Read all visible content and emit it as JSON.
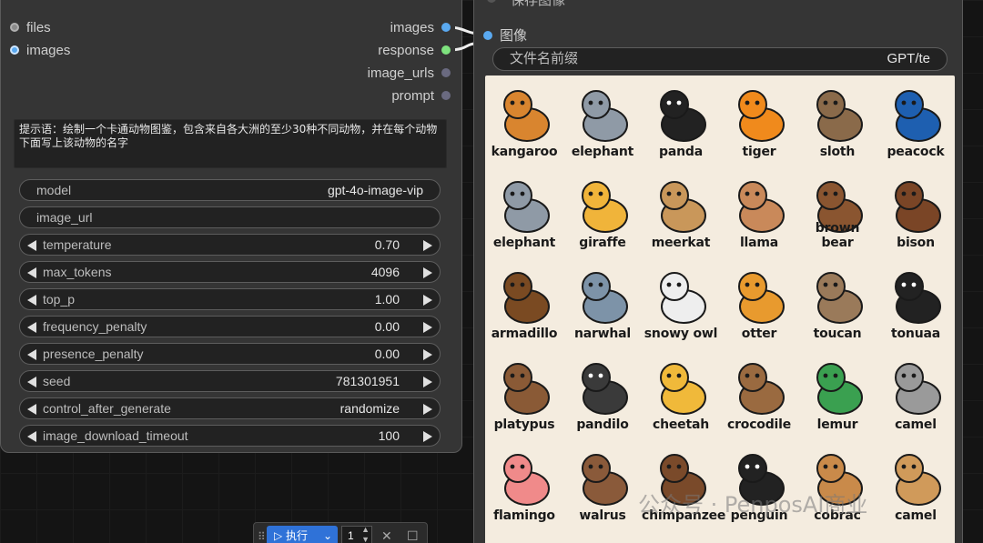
{
  "left_node": {
    "inputs": [
      {
        "label": "files",
        "color": "#8a8a8a"
      },
      {
        "label": "images",
        "color": "#5aa9f0"
      }
    ],
    "outputs": [
      {
        "label": "images",
        "color": "#5aa9f0"
      },
      {
        "label": "response",
        "color": "#7ee27e"
      },
      {
        "label": "image_urls",
        "color": "#6a6a80"
      },
      {
        "label": "prompt",
        "color": "#6a6a80"
      }
    ],
    "prompt_text": "提示语：绘制一个卡通动物图鉴，包含来自各大洲的至少30种不同动物，并在每个动物下面写上该动物的名字",
    "widgets": {
      "model": {
        "label": "model",
        "value": "gpt-4o-image-vip"
      },
      "image_url": {
        "label": "image_url",
        "value": ""
      },
      "temperature": {
        "label": "temperature",
        "value": "0.70"
      },
      "max_tokens": {
        "label": "max_tokens",
        "value": "4096"
      },
      "top_p": {
        "label": "top_p",
        "value": "1.00"
      },
      "frequency_penalty": {
        "label": "frequency_penalty",
        "value": "0.00"
      },
      "presence_penalty": {
        "label": "presence_penalty",
        "value": "0.00"
      },
      "seed": {
        "label": "seed",
        "value": "781301951"
      },
      "control_after_generate": {
        "label": "control_after_generate",
        "value": "randomize"
      },
      "image_download_timeout": {
        "label": "image_download_timeout",
        "value": "100"
      }
    }
  },
  "right_node": {
    "title": "保存图像",
    "input_label": "图像",
    "filename_prefix": {
      "label": "文件名前缀",
      "value": "GPT/te"
    },
    "animals": [
      {
        "name": "kangaroo",
        "color": "#d9852f"
      },
      {
        "name": "elephant",
        "color": "#8f9aa6"
      },
      {
        "name": "panda",
        "color": "#222222"
      },
      {
        "name": "tiger",
        "color": "#f08a1c"
      },
      {
        "name": "sloth",
        "color": "#8a6a4a"
      },
      {
        "name": "peacock",
        "color": "#1e5fb0"
      },
      {
        "name": "elephant",
        "color": "#8f9aa6"
      },
      {
        "name": "giraffe",
        "color": "#f0b43a"
      },
      {
        "name": "meerkat",
        "color": "#c9975a"
      },
      {
        "name": "llama",
        "color": "#c9895a"
      },
      {
        "name": "brown bear",
        "color": "#8a5530"
      },
      {
        "name": "bison",
        "color": "#7a4526"
      },
      {
        "name": "armadillo",
        "color": "#7a4a22"
      },
      {
        "name": "narwhal",
        "color": "#7d93a8"
      },
      {
        "name": "snowy owl",
        "color": "#eeeeee"
      },
      {
        "name": "otter",
        "color": "#e89a2e"
      },
      {
        "name": "toucan",
        "color": "#9a7a5a"
      },
      {
        "name": "tonuaa",
        "color": "#222222"
      },
      {
        "name": "platypus",
        "color": "#8a5a36"
      },
      {
        "name": "pandilo",
        "color": "#3a3a3a"
      },
      {
        "name": "cheetah",
        "color": "#f0b93a"
      },
      {
        "name": "crocodile",
        "color": "#9a6a40"
      },
      {
        "name": "lemur",
        "color": "#3aa050"
      },
      {
        "name": "camel",
        "color": "#9a9a9a"
      },
      {
        "name": "flamingo",
        "color": "#f08a8a"
      },
      {
        "name": "walrus",
        "color": "#8a5a3a"
      },
      {
        "name": "chimpanzee",
        "color": "#7a4a2a"
      },
      {
        "name": "penguin",
        "color": "#222222"
      },
      {
        "name": "cobrac",
        "color": "#c98a4a"
      },
      {
        "name": "camel",
        "color": "#d09a5a"
      }
    ],
    "watermark": "公众号 · PenposAI商业"
  },
  "toolbar": {
    "run_label": "▷ 执行",
    "run_caret": "⌄",
    "count": "1",
    "close_icon": "✕",
    "stop_icon": "☐"
  }
}
